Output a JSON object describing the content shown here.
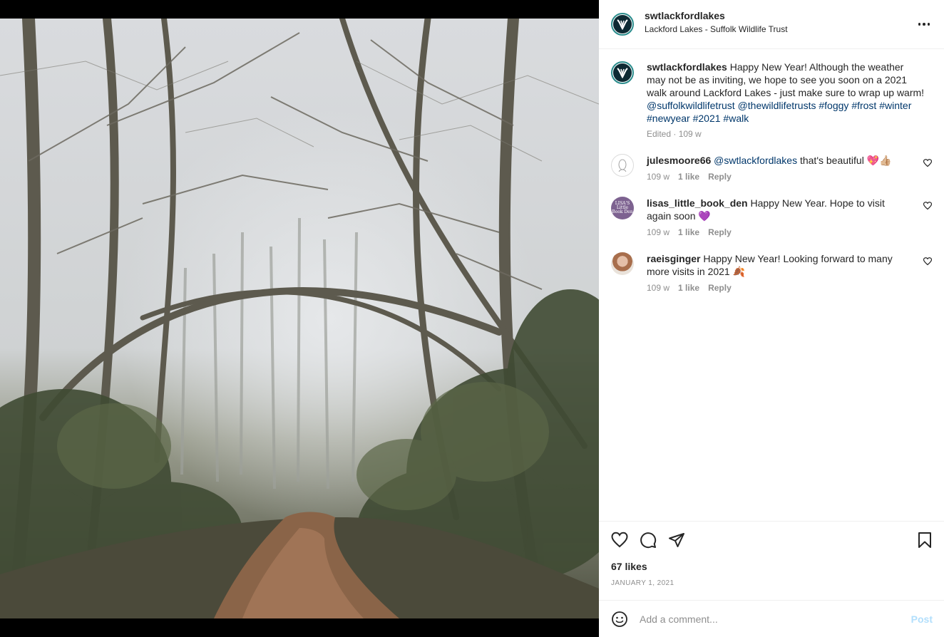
{
  "post": {
    "username": "swtlackfordlakes",
    "location": "Lackford Lakes - Suffolk Wildlife Trust"
  },
  "caption": {
    "username": "swtlackfordlakes",
    "text": "Happy New Year! Although the weather may not be as inviting, we hope to see you soon on a 2021 walk around Lackford Lakes - just make sure to wrap up warm!",
    "tags": [
      "@suffolkwildlifetrust",
      "@thewildlifetrusts",
      "#foggy",
      "#frost",
      "#winter",
      "#newyear",
      "#2021",
      "#walk"
    ],
    "meta": "Edited · 109 w"
  },
  "comments": [
    {
      "username": "julesmoore66",
      "mention": "@swtlackfordlakes",
      "text": "that's beautiful 💖👍🏼",
      "age": "109 w",
      "likes": "1 like",
      "reply": "Reply"
    },
    {
      "username": "lisas_little_book_den",
      "text": "Happy New Year. Hope to visit again soon 💜",
      "age": "109 w",
      "likes": "1 like",
      "reply": "Reply"
    },
    {
      "username": "raeisginger",
      "text": "Happy New Year! Looking forward to many more visits in 2021 🍂",
      "age": "109 w",
      "likes": "1 like",
      "reply": "Reply"
    }
  ],
  "actions": {
    "like_icon": "heart-icon",
    "comment_icon": "comment-bubble-icon",
    "share_icon": "paper-plane-icon",
    "save_icon": "bookmark-icon"
  },
  "likes": "67 likes",
  "date": "JANUARY 1, 2021",
  "composer": {
    "placeholder": "Add a comment...",
    "post_label": "Post",
    "emoji_icon": "smiley-icon"
  },
  "avatar_lisa_text": "LISA'S Little Book Den",
  "colors": {
    "link": "#00376b",
    "muted": "#8e8e8e",
    "post_disabled": "#b2dffc",
    "brand_ring": "#2a8c8c"
  }
}
